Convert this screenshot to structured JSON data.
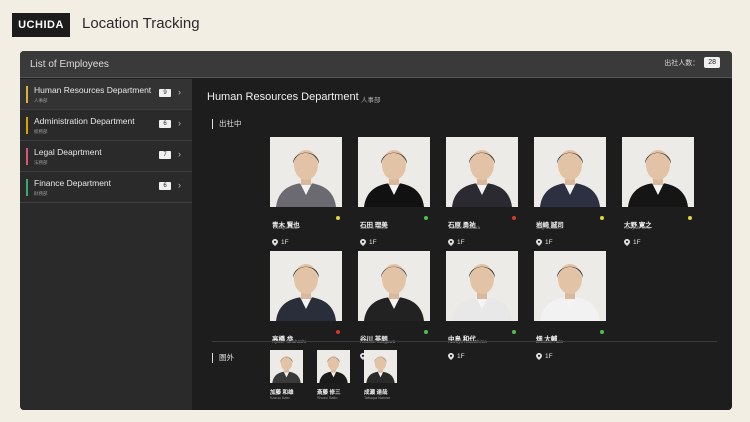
{
  "app": {
    "logo": "UCHIDA",
    "title": "Location Tracking"
  },
  "window": {
    "title": "List of Employees",
    "attendance_label": "出社人数：",
    "attendance_count": "28"
  },
  "sidebar": {
    "items": [
      {
        "name": "Human Resources Department",
        "sub": "人事部",
        "count": "9",
        "color": "#d9b23a"
      },
      {
        "name": "Administration Department",
        "sub": "総務部",
        "count": "6",
        "color": "#d9a000"
      },
      {
        "name": "Legal Deaprtment",
        "sub": "法務部",
        "count": "7",
        "color": "#d9566e"
      },
      {
        "name": "Finance Department",
        "sub": "財務部",
        "count": "6",
        "color": "#3aaa70"
      }
    ]
  },
  "main": {
    "dept_title": "Human Resources Department",
    "dept_sub": "人事部",
    "in_office_label": "出社中",
    "out_label": "圏外",
    "employees": [
      {
        "name": "青木 賢也",
        "roman": "Tetsuya Aoki",
        "floor": "1F",
        "status_color": "#e8d23a",
        "suit": "#6a6a70",
        "hair": "#1a1a1a"
      },
      {
        "name": "石田 理美",
        "roman": "Satomi Ishida",
        "floor": "1F",
        "status_color": "#4cc04c",
        "suit": "#111111",
        "hair": "#2a1c14"
      },
      {
        "name": "石原 勇祐",
        "roman": "Yusuke Ishihara",
        "floor": "1F",
        "status_color": "#d23a2a",
        "suit": "#2a2a30",
        "hair": "#1a1a1a"
      },
      {
        "name": "岩崎 誠司",
        "roman": "Seiji Iwasaki",
        "floor": "1F",
        "status_color": "#e8d23a",
        "suit": "#2c3040",
        "hair": "#1a1a1a"
      },
      {
        "name": "大野 寛之",
        "roman": "Hiroyuki Ono",
        "floor": "1F",
        "status_color": "#e8d23a",
        "suit": "#151515",
        "hair": "#1a1a1a"
      },
      {
        "name": "高橋 歩",
        "roman": "Ayumi Takahashi",
        "floor": "1F",
        "status_color": "#d23a2a",
        "suit": "#2a2d3a",
        "hair": "#1a1a1a"
      },
      {
        "name": "谷川 英朗",
        "roman": "Hideaki Tanigawa",
        "floor": "1F",
        "status_color": "#4cc04c",
        "suit": "#222222",
        "hair": "#444444"
      },
      {
        "name": "中島 和代",
        "roman": "Kazuyo Nakashima",
        "floor": "1F",
        "status_color": "#4cc04c",
        "suit": "#e8e8e8",
        "hair": "#1a1a1a"
      },
      {
        "name": "畑 大輔",
        "roman": "Daisuke Hata",
        "floor": "1F",
        "status_color": "#4cc04c",
        "suit": "#f2f2f2",
        "hair": "#1a1a1a"
      }
    ],
    "out_employees": [
      {
        "name": "加藤 和雄",
        "roman": "Kazuo Kato",
        "suit": "#3a3a3a",
        "hair": "#222222"
      },
      {
        "name": "斎藤 修三",
        "roman": "Shuzo Saito",
        "suit": "#1a1a1a",
        "hair": "#222222"
      },
      {
        "name": "成瀬 達哉",
        "roman": "Tatsuya Naruse",
        "suit": "#2a2a2a",
        "hair": "#555555"
      }
    ]
  }
}
